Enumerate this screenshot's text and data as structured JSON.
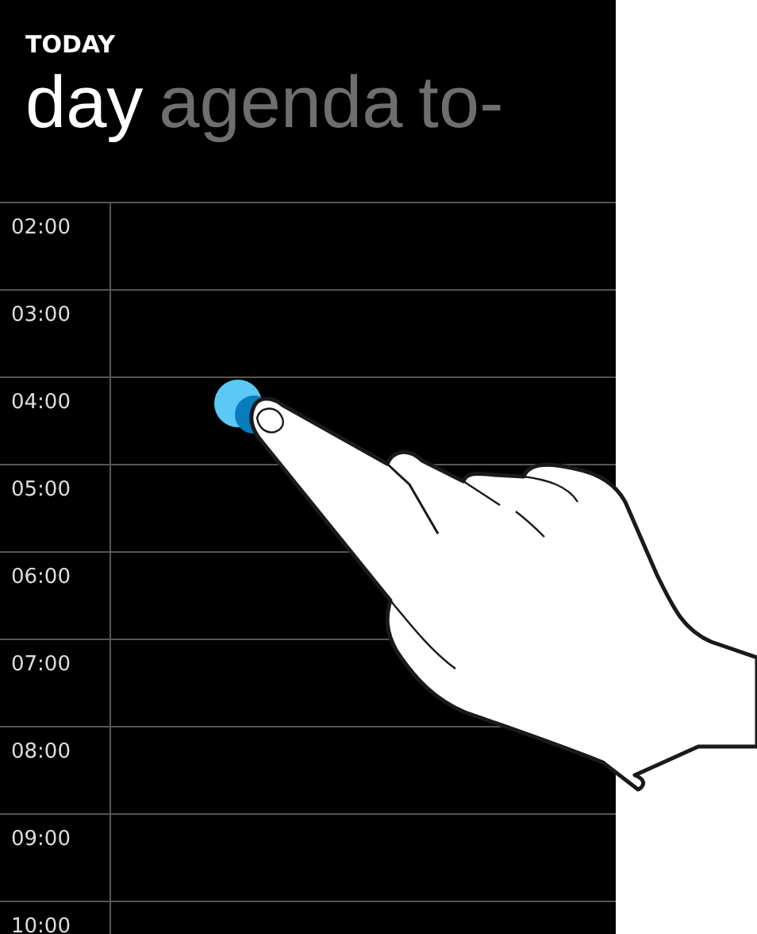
{
  "header": {
    "title": "TODAY"
  },
  "pivot_tabs": [
    {
      "label": "day",
      "selected": true
    },
    {
      "label": "agenda",
      "selected": false
    },
    {
      "label": "to-",
      "selected": false
    }
  ],
  "hours": [
    {
      "label": "02:00"
    },
    {
      "label": "03:00"
    },
    {
      "label": "04:00"
    },
    {
      "label": "05:00"
    },
    {
      "label": "06:00"
    },
    {
      "label": "07:00"
    },
    {
      "label": "08:00"
    },
    {
      "label": "09:00"
    },
    {
      "label": "10:00"
    }
  ]
}
